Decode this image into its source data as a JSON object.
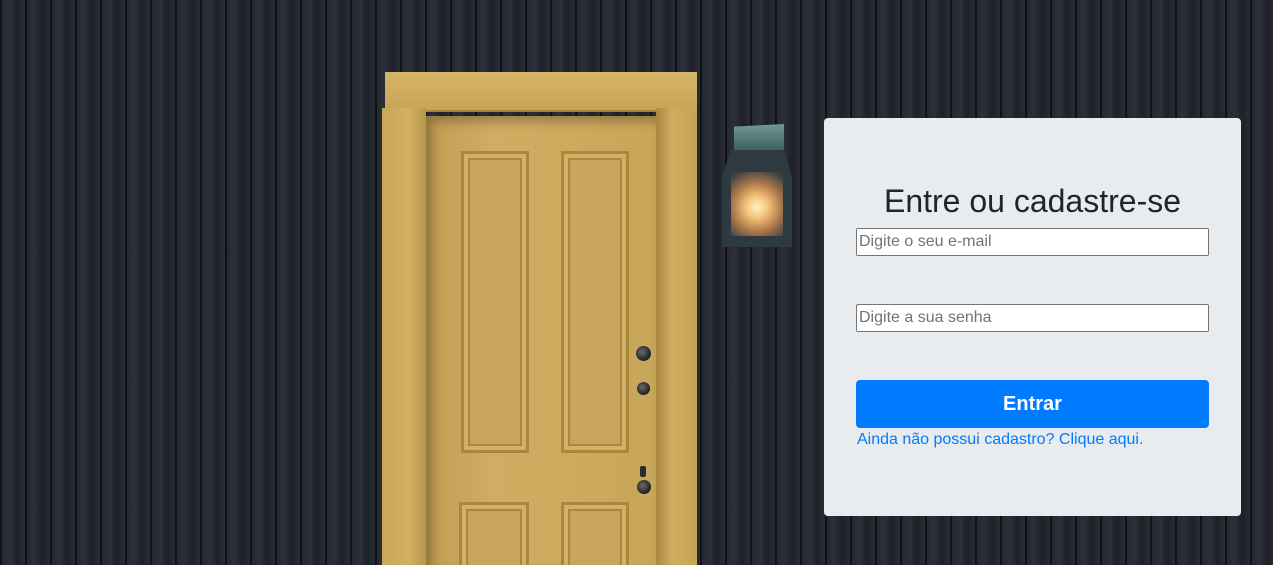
{
  "background": {
    "description_icon": "door-with-lantern-photo"
  },
  "login": {
    "title": "Entre ou cadastre-se",
    "email_placeholder": "Digite o seu e-mail",
    "email_value": "",
    "password_placeholder": "Digite a sua senha",
    "password_value": "",
    "submit_label": "Entrar",
    "signup_link": "Ainda não possui cadastro? Clique aqui."
  },
  "colors": {
    "card_background": "#e9ecef",
    "primary": "#007bff",
    "title_text": "#212529"
  }
}
